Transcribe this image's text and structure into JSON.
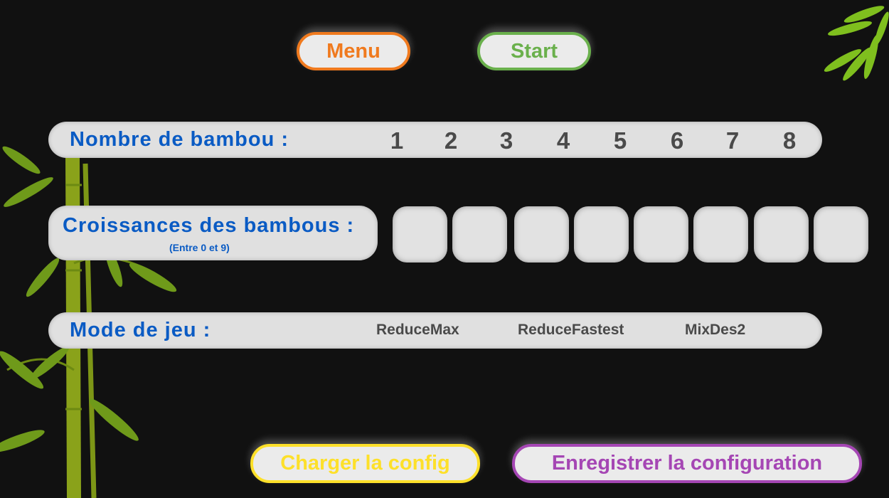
{
  "top_buttons": {
    "menu": "Menu",
    "start": "Start"
  },
  "bamboo_count": {
    "label": "Nombre de bambou :",
    "options": [
      "1",
      "2",
      "3",
      "4",
      "5",
      "6",
      "7",
      "8"
    ]
  },
  "growth": {
    "label": "Croissances des bambous :",
    "hint": "(Entre 0 et 9)",
    "values": [
      "",
      "",
      "",
      "",
      "",
      "",
      "",
      ""
    ]
  },
  "game_mode": {
    "label": "Mode de jeu :",
    "options": [
      "ReduceMax",
      "ReduceFastest",
      "MixDes2"
    ]
  },
  "bottom_buttons": {
    "load": "Charger la config",
    "save": "Enregistrer la configuration"
  },
  "colors": {
    "menu": "#f07a1e",
    "start": "#6ab04c",
    "load": "#fde02a",
    "save": "#a546b4",
    "label": "#0a5bc4",
    "background": "#111111"
  }
}
